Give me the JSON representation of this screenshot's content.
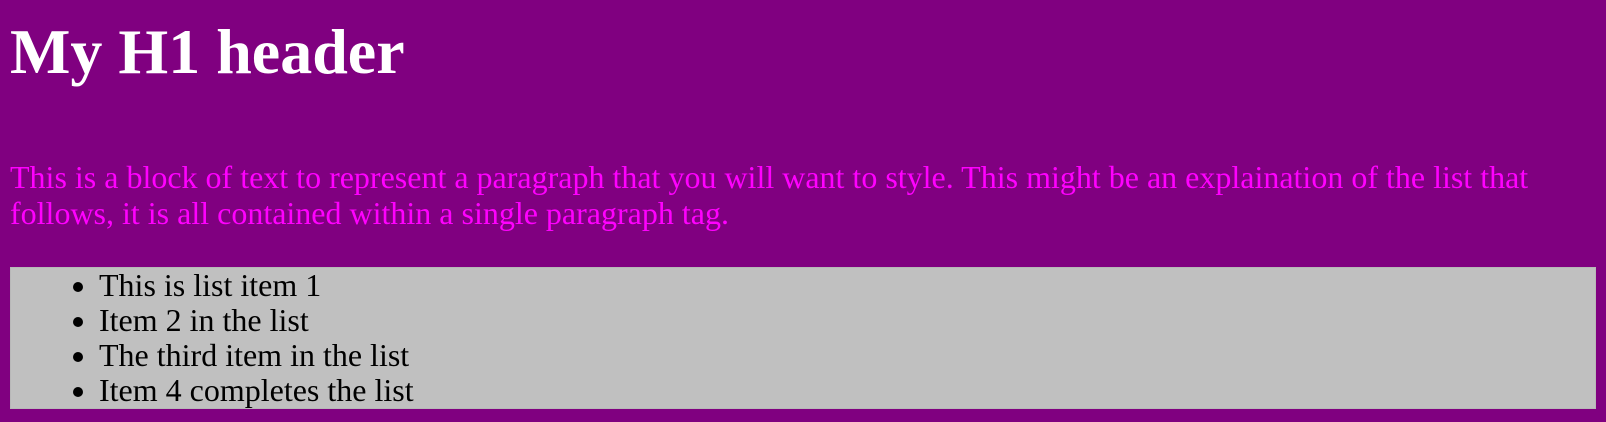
{
  "page": {
    "title": "My H1 header",
    "paragraph": "This is a block of text to represent a paragraph that you will want to style. This might be an explaination of the list that follows, it is all contained within a single paragraph tag.",
    "list_items": [
      "This is list item 1",
      "Item 2 in the list",
      "The third item in the list",
      "Item 4 completes the list"
    ]
  },
  "colors": {
    "background": "#800080",
    "heading": "#ffffff",
    "paragraph": "#ff00ff",
    "list_background": "#c0c0c0",
    "list_text": "#000000"
  }
}
